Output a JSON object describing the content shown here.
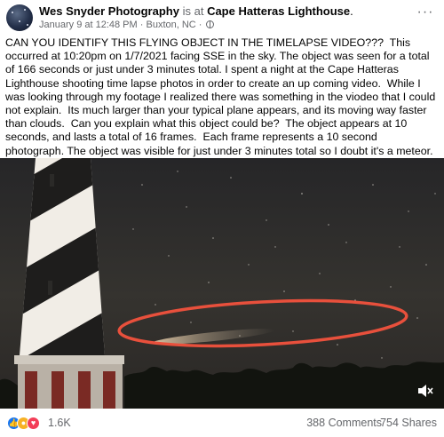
{
  "post": {
    "author": "Wes Snyder Photography",
    "checkin_connector": "is at",
    "place": "Cape Hatteras Lighthouse",
    "period": ".",
    "date": "January 9 at 12:48 PM",
    "separator": "·",
    "location": "Buxton, NC",
    "separator2": "·",
    "more_label": "···",
    "text": "CAN YOU IDENTIFY THIS FLYING OBJECT IN THE TIMELAPSE VIDEO???  This occurred at 10:20pm on 1/7/2021 facing SSE in the sky. The object was seen for a total of 166 seconds or just under 3 minutes total. I spent a night at the Cape Hatteras Lighthouse shooting time lapse photos in order to create an up coming video.  While I was looking through my footage I realized there was something in the viodeo that I could not explain.  Its much larger than your typical plane appears, and its moving way faster than clouds.  Can you explain what this object could be?  The object appears at 10 seconds, and lasts a total of 16 frames.  Each frame represents a 10 second photograph. The object was visible for just under 3 minutes total so I doubt it's a meteor."
  },
  "media": {
    "highlight_color": "#e8503c",
    "icons": [
      "mute-icon"
    ]
  },
  "footer": {
    "reactions": [
      "like-icon",
      "wow-icon",
      "love-icon"
    ],
    "reaction_count": "1.6K",
    "comments": "388 Comments",
    "shares": "754 Shares"
  }
}
